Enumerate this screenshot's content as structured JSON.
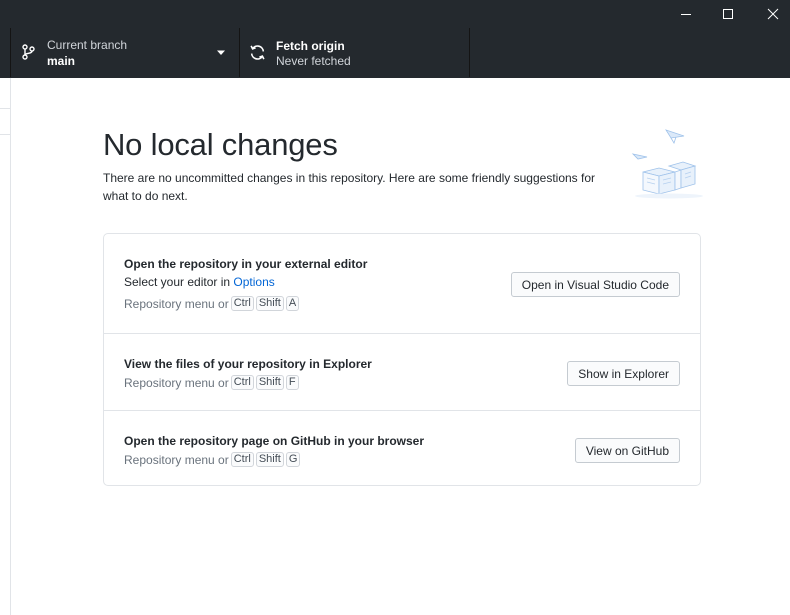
{
  "window": {
    "controls": [
      "minimize-icon",
      "maximize-icon",
      "close-icon"
    ]
  },
  "toolbar": {
    "branch": {
      "title": "Current branch",
      "value": "main",
      "icon": "git-branch-icon"
    },
    "fetch": {
      "title": "Fetch origin",
      "description": "Never fetched",
      "icon": "sync-icon"
    }
  },
  "main": {
    "heading": "No local changes",
    "intro": "There are no uncommitted changes in this repository. Here are some friendly suggestions for what to do next.",
    "actions": [
      {
        "title": "Open the repository in your external editor",
        "subtitle_prefix": "Select your editor in ",
        "subtitle_link": "Options",
        "hint": "Repository menu or",
        "keys": [
          "Ctrl",
          "Shift",
          "A"
        ],
        "button": "Open in Visual Studio Code"
      },
      {
        "title": "View the files of your repository in Explorer",
        "hint": "Repository menu or",
        "keys": [
          "Ctrl",
          "Shift",
          "F"
        ],
        "button": "Show in Explorer"
      },
      {
        "title": "Open the repository page on GitHub in your browser",
        "hint": "Repository menu or",
        "keys": [
          "Ctrl",
          "Shift",
          "G"
        ],
        "button": "View on GitHub"
      }
    ]
  },
  "colors": {
    "toolbar_bg": "#24292e",
    "text": "#24292e",
    "muted": "#6a737d",
    "link": "#0366d6",
    "border": "#e1e4e8"
  }
}
